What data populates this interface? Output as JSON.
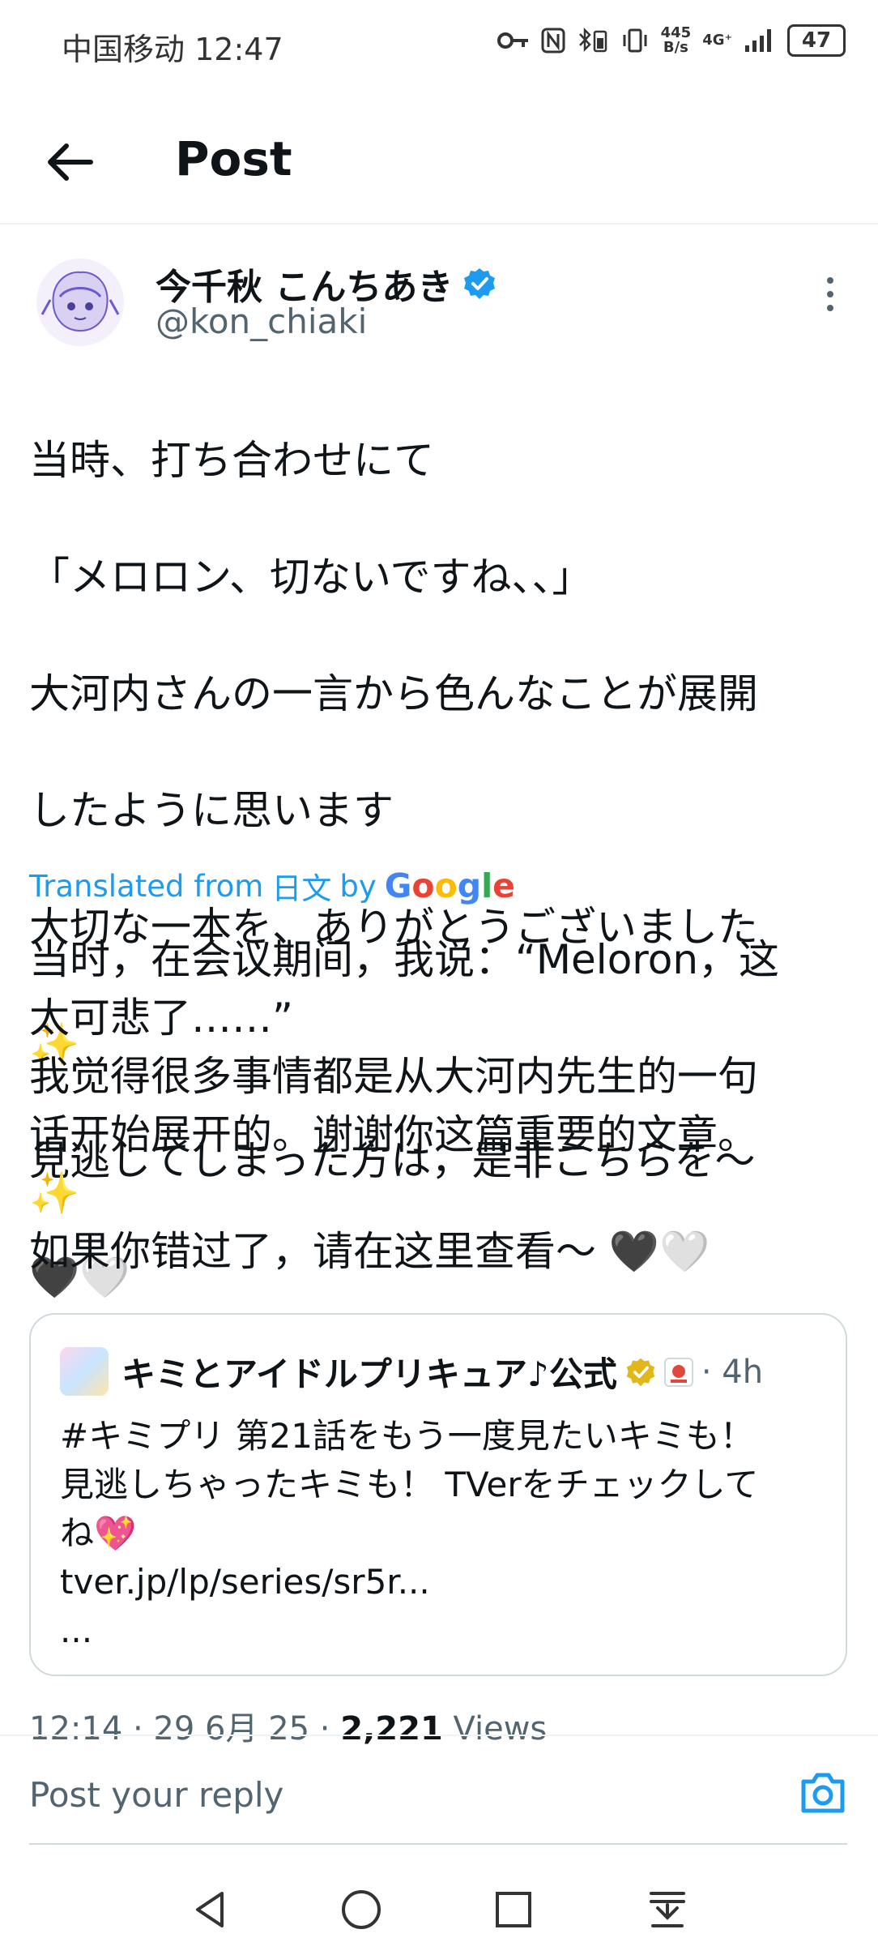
{
  "status_bar": {
    "carrier": "中国移动",
    "time": "12:47",
    "net_speed_value": "445",
    "net_speed_unit": "B/s",
    "network": "4G⁺",
    "battery": "47"
  },
  "header": {
    "title": "Post"
  },
  "author": {
    "name": "今千秋 こんちあき",
    "handle": "@kon_chiaki"
  },
  "tweet": {
    "lines": [
      "当時、打ち合わせにて",
      "「メロロン、切ないですね、、」",
      "大河内さんの一言から色んなことが展開",
      "したように思います",
      "大切な一本を、ありがとうございました",
      "✨",
      "見逃してしまった方は，是非こちらを～",
      "🖤🤍"
    ]
  },
  "translation": {
    "label_prefix": "Translated from",
    "label_lang": "日文",
    "label_by": "by",
    "provider": "Google",
    "lines": [
      "当时，在会议期间，我说：“Meloron，这",
      "太可悲了……”",
      "我觉得很多事情都是从大河内先生的一句",
      "话开始展开的。谢谢你这篇重要的文章。",
      "✨",
      "如果你错过了，请在这里查看～ 🖤🤍"
    ]
  },
  "quote": {
    "name": "キミとアイドルプリキュア♪公式",
    "time": "· 4h",
    "lines": [
      "#キミプリ 第21話をもう一度見たいキミも！",
      "見逃しちゃったキミも！ TVerをチェックして",
      "ね💖",
      "tver.jp/lp/series/sr5r...",
      "..."
    ]
  },
  "meta": {
    "timestamp": "12:14 · 29 6月 25 ·",
    "views_count": "2,221",
    "views_label": "Views"
  },
  "reply": {
    "placeholder": "Post your reply"
  },
  "colors": {
    "accent": "#1d9bf0",
    "text": "#0f1419",
    "secondary": "#536471",
    "border": "#cfd9de"
  },
  "icons": [
    "back-arrow-icon",
    "verified-badge-icon",
    "more-vertical-icon",
    "camera-icon",
    "nav-back-icon",
    "nav-home-icon",
    "nav-recents-icon",
    "nav-menu-icon"
  ]
}
